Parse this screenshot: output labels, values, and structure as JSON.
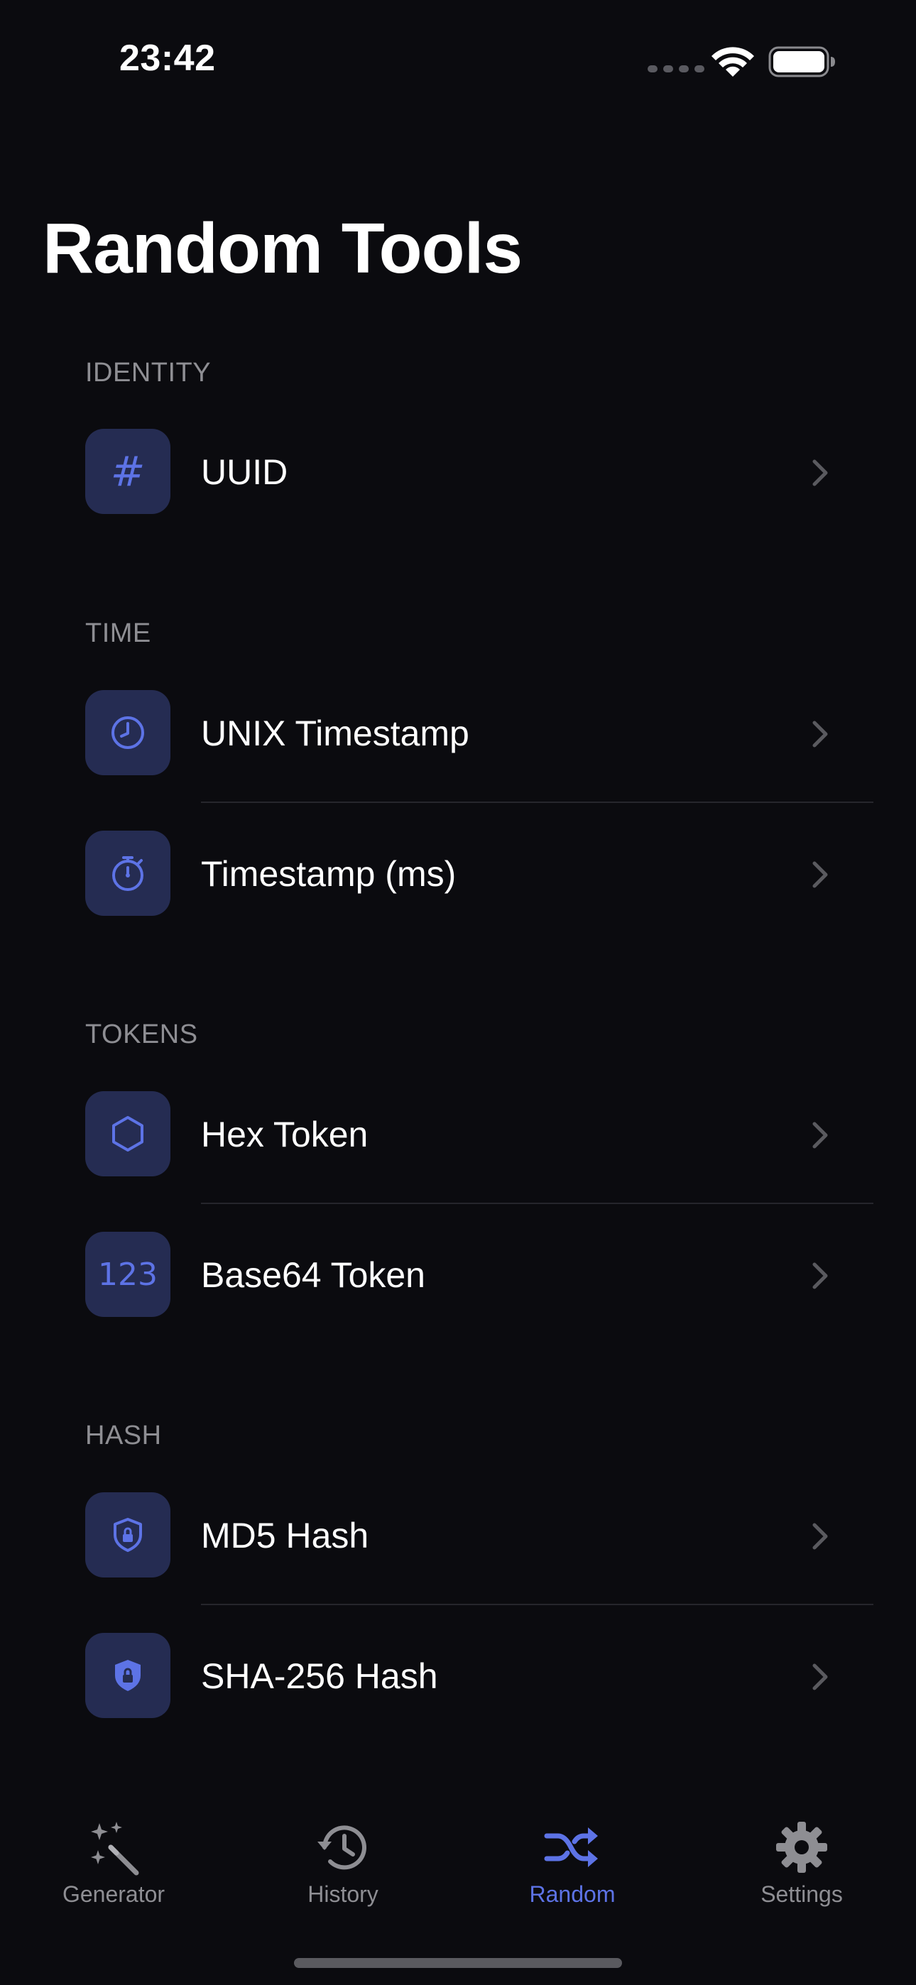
{
  "status_bar": {
    "time": "23:42"
  },
  "title": "Random Tools",
  "colors": {
    "background": "#0b0b0f",
    "accent": "#5d73e6",
    "icon_tile": "#252c52",
    "secondary_text": "#8e8e93"
  },
  "sections": {
    "identity": {
      "header": "IDENTITY",
      "items": [
        {
          "label": "UUID",
          "icon": "hash-icon"
        }
      ]
    },
    "time": {
      "header": "TIME",
      "items": [
        {
          "label": "UNIX Timestamp",
          "icon": "clock-icon"
        },
        {
          "label": "Timestamp (ms)",
          "icon": "stopwatch-icon"
        }
      ]
    },
    "tokens": {
      "header": "TOKENS",
      "items": [
        {
          "label": "Hex Token",
          "icon": "hexagon-icon"
        },
        {
          "label": "Base64 Token",
          "icon": "numbers-icon",
          "glyph": "123"
        }
      ]
    },
    "hash": {
      "header": "HASH",
      "items": [
        {
          "label": "MD5 Hash",
          "icon": "lock-shield-outline-icon"
        },
        {
          "label": "SHA-256 Hash",
          "icon": "lock-shield-filled-icon"
        }
      ]
    }
  },
  "tab_bar": {
    "active": "Random",
    "tabs": [
      {
        "label": "Generator",
        "icon": "magic-wand-icon"
      },
      {
        "label": "History",
        "icon": "history-clock-icon"
      },
      {
        "label": "Random",
        "icon": "shuffle-icon"
      },
      {
        "label": "Settings",
        "icon": "gear-icon"
      }
    ]
  }
}
